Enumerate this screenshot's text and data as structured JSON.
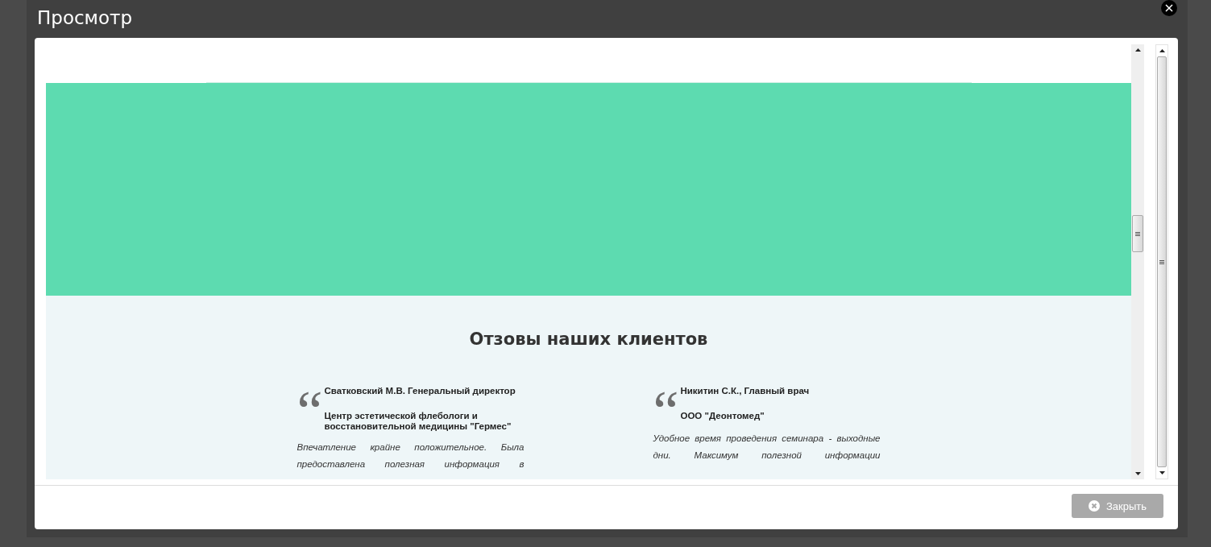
{
  "dialog": {
    "title": "Просмотр",
    "close_button": "Закрыть"
  },
  "preview": {
    "heading": "Отзовы наших клиентов",
    "reviews": [
      {
        "quote_mark": "“",
        "author": "Сватковский М.В. Генеральный директор",
        "company": "Центр эстетической флебологи и восстановительной медицины \"Гермес\"",
        "text": "Впечатление крайне положительное. Была предоставлена полезная информация в"
      },
      {
        "quote_mark": "“",
        "author": "Никитин С.К., Главный врач",
        "company": "ООО \"Деонтомед\"",
        "text": "Удобное время проведения семинара - выходные дни. Максимум полезной информации"
      }
    ]
  }
}
